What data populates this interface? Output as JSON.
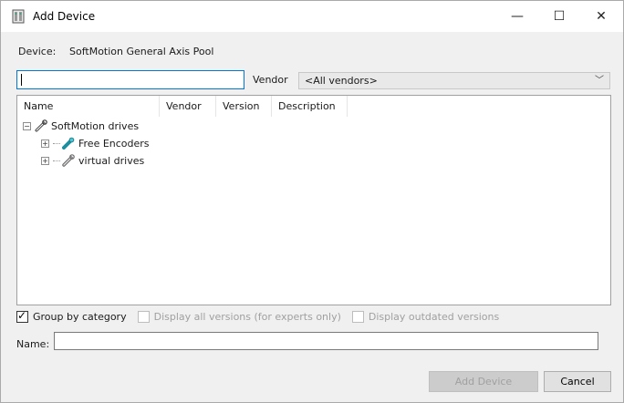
{
  "window": {
    "title": "Add Device",
    "minimize_glyph": "—",
    "maximize_glyph": "☐",
    "close_glyph": "✕"
  },
  "device": {
    "label": "Device:",
    "value": "SoftMotion General Axis Pool"
  },
  "search": {
    "value": "",
    "placeholder": ""
  },
  "vendor": {
    "label": "Vendor",
    "selected": "<All vendors>"
  },
  "tree": {
    "columns": [
      "Name",
      "Vendor",
      "Version",
      "Description"
    ],
    "nodes": [
      {
        "label": "SoftMotion drives",
        "icon": "wrench-icon",
        "expander": "−"
      },
      {
        "label": "Free Encoders",
        "icon": "encoder-icon",
        "expander": "+"
      },
      {
        "label": "virtual drives",
        "icon": "wrench-icon",
        "expander": "+"
      }
    ]
  },
  "options": {
    "group_by_category": {
      "label": "Group by category",
      "checked": true
    },
    "display_all_versions": {
      "label": "Display all versions (for experts only)",
      "checked": false,
      "enabled": false
    },
    "display_outdated": {
      "label": "Display outdated versions",
      "checked": false,
      "enabled": false
    }
  },
  "name_field": {
    "label": "Name:",
    "value": ""
  },
  "buttons": {
    "add_device": "Add Device",
    "cancel": "Cancel"
  },
  "colors": {
    "focus_border": "#0078d7",
    "dialog_bg": "#f0f0f0",
    "disabled_text": "#a0a0a0"
  }
}
